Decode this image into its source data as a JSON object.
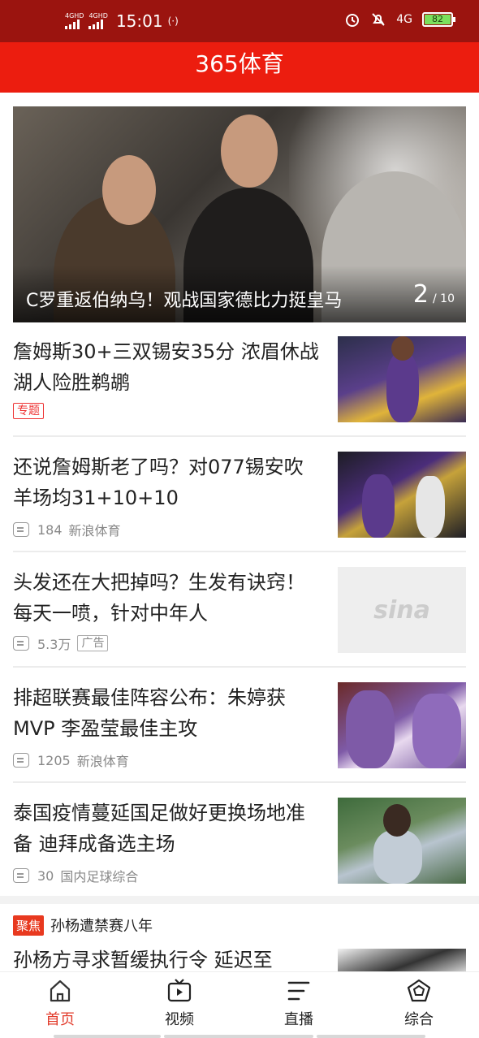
{
  "status_bar": {
    "net1": "4GHD",
    "net2": "4GHD",
    "time": "15:01",
    "hotspot": "(·)",
    "net3": "4G",
    "battery": "82"
  },
  "app": {
    "title": "365体育"
  },
  "banner": {
    "title": "C罗重返伯纳乌！观战国家德比力挺皇马",
    "current": "2",
    "total": "/ 10"
  },
  "news": [
    {
      "title": "詹姆斯30+三双锡安35分 浓眉休战湖人险胜鹈鹕",
      "tag": "专题"
    },
    {
      "title": "还说詹姆斯老了吗？对077锡安吹羊场均31+10+10",
      "comments": "184",
      "source": "新浪体育"
    },
    {
      "title": "头发还在大把掉吗？生发有诀窍！每天一喷，针对中年人",
      "comments": "5.3万",
      "tag": "广告",
      "thumb_logo": "sina"
    },
    {
      "title": "排超联赛最佳阵容公布：朱婷获MVP 李盈莹最佳主攻",
      "comments": "1205",
      "source": "新浪体育"
    },
    {
      "title": "泰国疫情蔓延国足做好更换场地准备 迪拜成备选主场",
      "comments": "30",
      "source": "国内足球综合"
    },
    {
      "title": "孙杨方寻求暂缓执行令 延迟至"
    }
  ],
  "focus": {
    "badge": "聚焦",
    "text": "孙杨遭禁赛八年"
  },
  "tabs": [
    {
      "label": "首页",
      "icon": "home-icon"
    },
    {
      "label": "视频",
      "icon": "video-icon"
    },
    {
      "label": "直播",
      "icon": "live-icon"
    },
    {
      "label": "综合",
      "icon": "pentagon-icon"
    }
  ],
  "colors": {
    "accent": "#ec1d0f",
    "status_bar": "#9b140f",
    "active_tab": "#e23a2a"
  }
}
